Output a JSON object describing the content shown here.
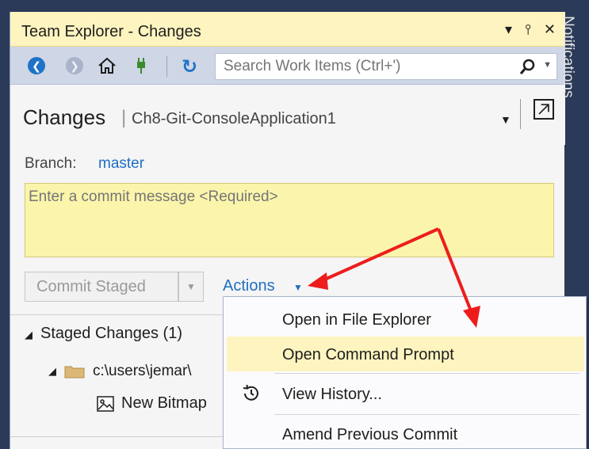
{
  "window": {
    "title": "Team Explorer - Changes",
    "controls": [
      "dropdown",
      "pin",
      "close"
    ]
  },
  "toolbar": {
    "search_placeholder": "Search Work Items (Ctrl+')"
  },
  "header": {
    "title": "Changes",
    "separator": "|",
    "repo": "Ch8-Git-ConsoleApplication1"
  },
  "branch": {
    "label": "Branch:",
    "value": "master"
  },
  "commit": {
    "placeholder": "Enter a commit message <Required>",
    "button_label": "Commit Staged",
    "actions_label": "Actions"
  },
  "tree": {
    "staged": "Staged Changes (1)",
    "folder": "c:\\users\\jemar\\",
    "file": "New Bitmap"
  },
  "side_strip": {
    "label": "Notifications"
  },
  "menu": {
    "items": [
      {
        "label": "Open in File Explorer",
        "highlighted": false
      },
      {
        "label": "Open Command Prompt",
        "highlighted": true
      },
      {
        "label": "View History...",
        "highlighted": false,
        "icon": "history-icon"
      },
      {
        "label": "Amend Previous Commit",
        "highlighted": false
      }
    ]
  },
  "colors": {
    "accent_blue": "#1e6fc3",
    "title_bar": "#fdf4bf",
    "commit_box": "#fbf5ac",
    "annotation_red": "#ee1c1c"
  }
}
